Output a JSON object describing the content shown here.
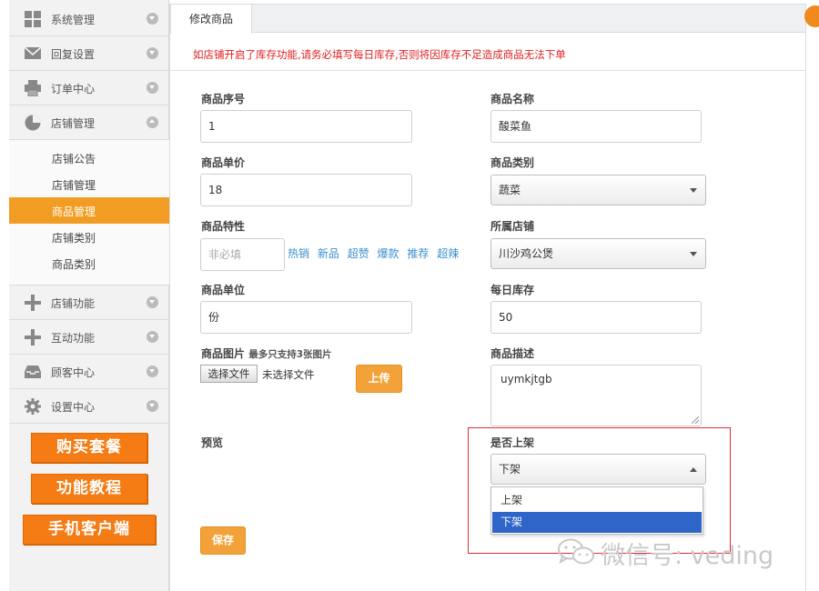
{
  "sidebar": {
    "menu": [
      {
        "label": "系统管理",
        "icon": "grid-icon",
        "expanded": false
      },
      {
        "label": "回复设置",
        "icon": "envelope-icon",
        "expanded": false
      },
      {
        "label": "订单中心",
        "icon": "printer-icon",
        "expanded": false
      },
      {
        "label": "店铺管理",
        "icon": "pie-chart-icon",
        "expanded": true
      },
      {
        "label": "店铺功能",
        "icon": "plus-icon",
        "expanded": false
      },
      {
        "label": "互动功能",
        "icon": "plus-icon",
        "expanded": false
      },
      {
        "label": "顾客中心",
        "icon": "inbox-icon",
        "expanded": false
      },
      {
        "label": "设置中心",
        "icon": "gear-icon",
        "expanded": false
      }
    ],
    "submenu": [
      {
        "label": "店铺公告",
        "active": false
      },
      {
        "label": "店铺管理",
        "active": false
      },
      {
        "label": "商品管理",
        "active": true
      },
      {
        "label": "店铺类别",
        "active": false
      },
      {
        "label": "商品类别",
        "active": false
      }
    ],
    "promo_buttons": [
      "购买套餐",
      "功能教程",
      "手机客户端"
    ],
    "accent_color": "#f19d23",
    "promo_color": "#f57c14"
  },
  "tabs": [
    {
      "label": "修改商品",
      "active": true
    }
  ],
  "notice": "如店铺开启了库存功能,请务必填写每日库存,否则将因库存不足造成商品无法下单",
  "form": {
    "seq": {
      "label": "商品序号",
      "value": "1"
    },
    "name": {
      "label": "商品名称",
      "value": "酸菜鱼"
    },
    "price": {
      "label": "商品单价",
      "value": "18"
    },
    "category": {
      "label": "商品类别",
      "value": "蔬菜"
    },
    "features": {
      "label": "商品特性",
      "placeholder": "非必填",
      "tags": [
        "热销",
        "新品",
        "超赞",
        "爆款",
        "推荐",
        "超辣"
      ]
    },
    "store": {
      "label": "所属店铺",
      "value": "川沙鸡公煲"
    },
    "unit": {
      "label": "商品单位",
      "value": "份"
    },
    "stock": {
      "label": "每日库存",
      "value": "50"
    },
    "image": {
      "label": "商品图片",
      "hint": "最多只支持3张图片",
      "choose_button": "选择文件",
      "no_file_text": "未选择文件",
      "upload_button": "上传"
    },
    "description": {
      "label": "商品描述",
      "value": "uymkjtgb"
    },
    "preview": {
      "label": "预览"
    },
    "listing": {
      "label": "是否上架",
      "value": "下架",
      "options": [
        "上架",
        "下架"
      ],
      "highlighted_option": "下架"
    },
    "save_button": "保存"
  },
  "watermark": {
    "text": "微信号: veding"
  },
  "colors": {
    "notice": "#e02020",
    "tag_link": "#3a8fd0",
    "button_orange": "#f3a23a",
    "option_highlight": "#2f64c8",
    "highlight_box": "#e03030"
  }
}
